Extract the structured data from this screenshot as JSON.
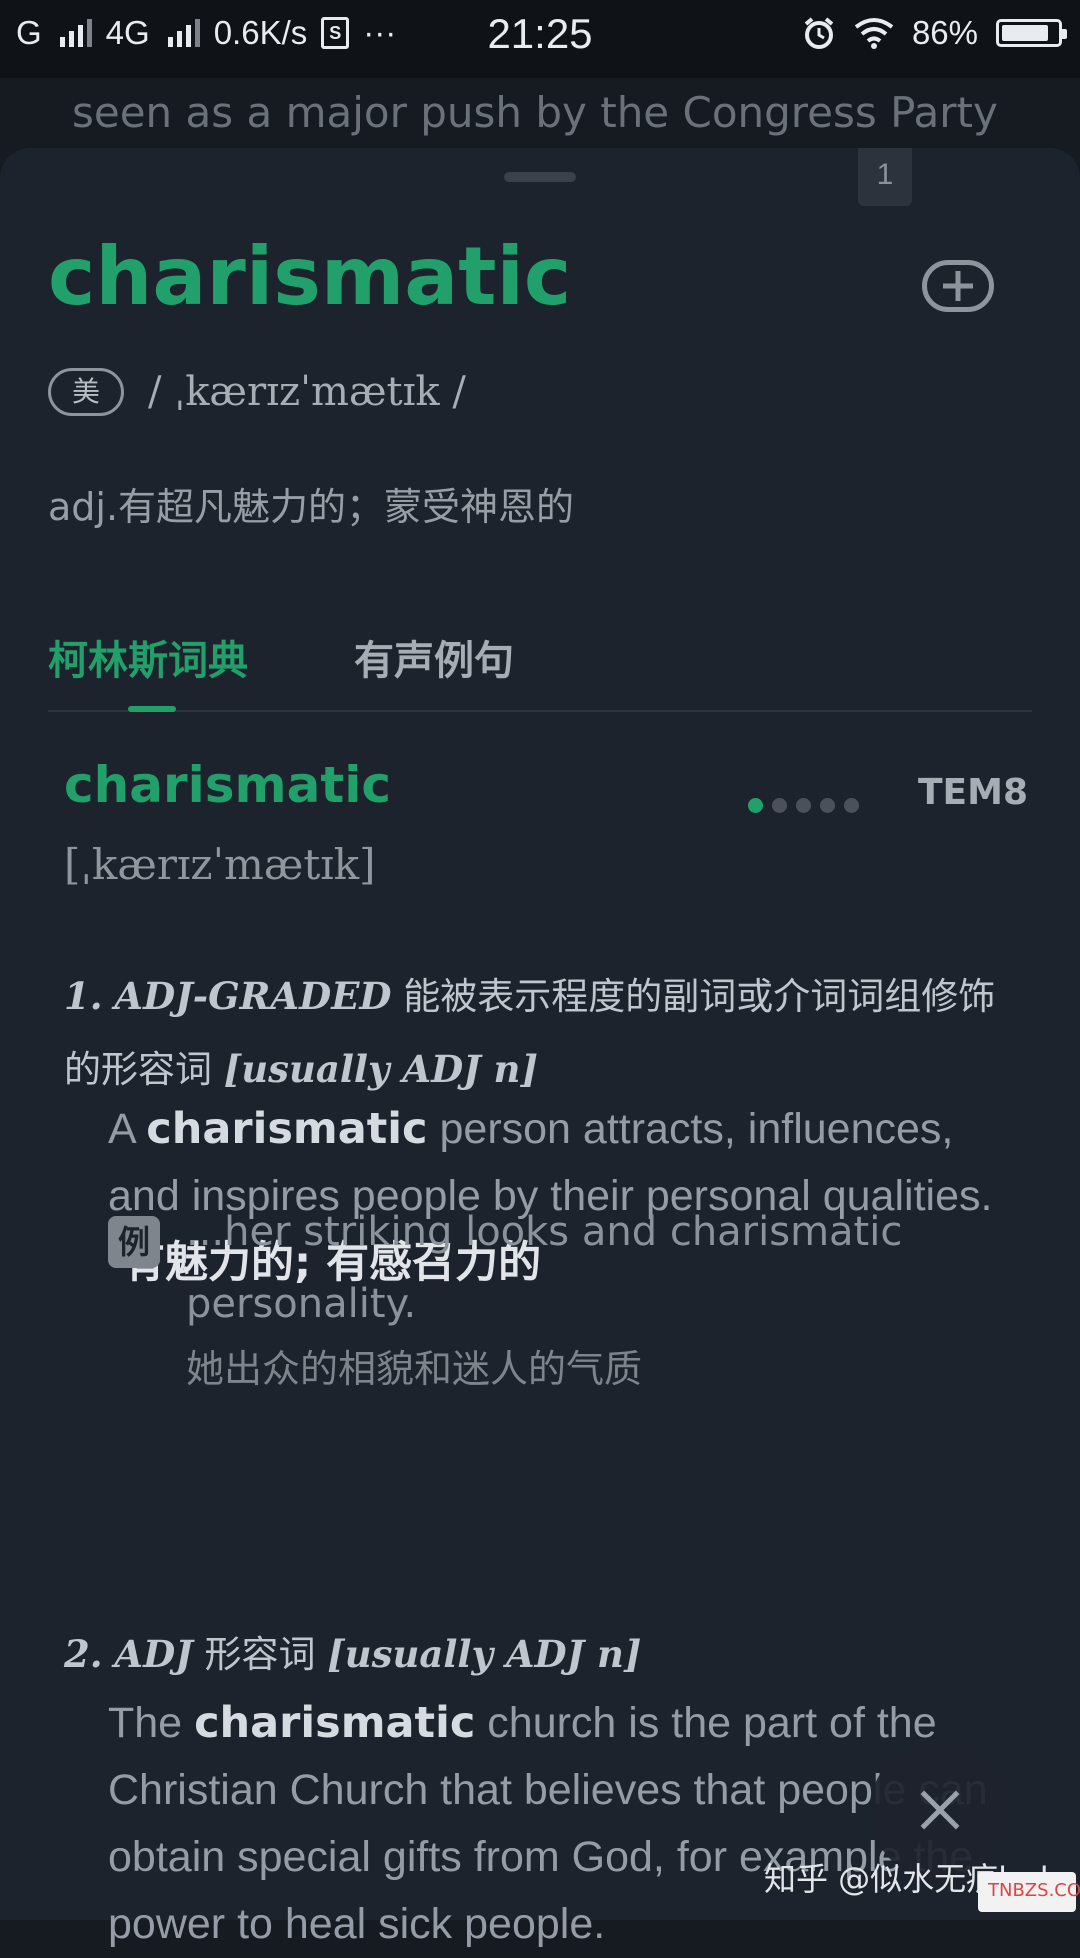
{
  "status_bar": {
    "carrier1": "G",
    "carrier2": "4G",
    "speed": "0.6K/s",
    "sim_label": "S",
    "more": "···",
    "time": "21:25",
    "battery_percent": "86%",
    "battery_level": 0.86,
    "icons": [
      "signal-icon",
      "alarm-icon",
      "wifi-icon",
      "battery-icon"
    ]
  },
  "background": {
    "article_text": "seen as a major push by the Congress Party"
  },
  "sheet": {
    "tab_count_badge": "1",
    "headword": "charismatic",
    "accent_label": "美",
    "phonetic": "/ ˌkærɪzˈmætɪk /",
    "brief_definition": "adj.有超凡魅力的；蒙受神恩的"
  },
  "tabs": [
    {
      "label": "柯林斯词典",
      "active": true
    },
    {
      "label": "有声例句",
      "active": false
    }
  ],
  "collins": {
    "word": "charismatic",
    "stars": 1,
    "star_total": 5,
    "level": "TEM8",
    "phonetic": "[ˌkærɪzˈmætɪk]",
    "senses": [
      {
        "number": "1.",
        "gram": "ADJ-GRADED",
        "gram_cn": "能被表示程度的副词或介词词组修饰的形容词",
        "usage": "[usually ADJ n]",
        "def_pre": "A",
        "def_word": "charismatic",
        "def_post": "person attracts, influences, and inspires people by their personal qualities.",
        "def_cn": "有魅力的; 有感召力的",
        "example_label": "例",
        "example_en": "...her striking looks and charismatic personality.",
        "example_cn": "她出众的相貌和迷人的气质"
      },
      {
        "number": "2.",
        "gram": "ADJ",
        "gram_cn": "形容词",
        "usage": "[usually ADJ n]",
        "def_pre": "The",
        "def_word": "charismatic",
        "def_post": "church is the part of the Christian Church that believes that people can obtain special gifts from God, for example the power to heal sick people."
      }
    ]
  },
  "overlay": {
    "watermark": "知乎 @似水无痕lark",
    "site_logo": "TNBZS.COM"
  },
  "colors": {
    "accent": "#22a06b",
    "sheet_bg": "#1d232c",
    "page_bg": "#161b22"
  }
}
